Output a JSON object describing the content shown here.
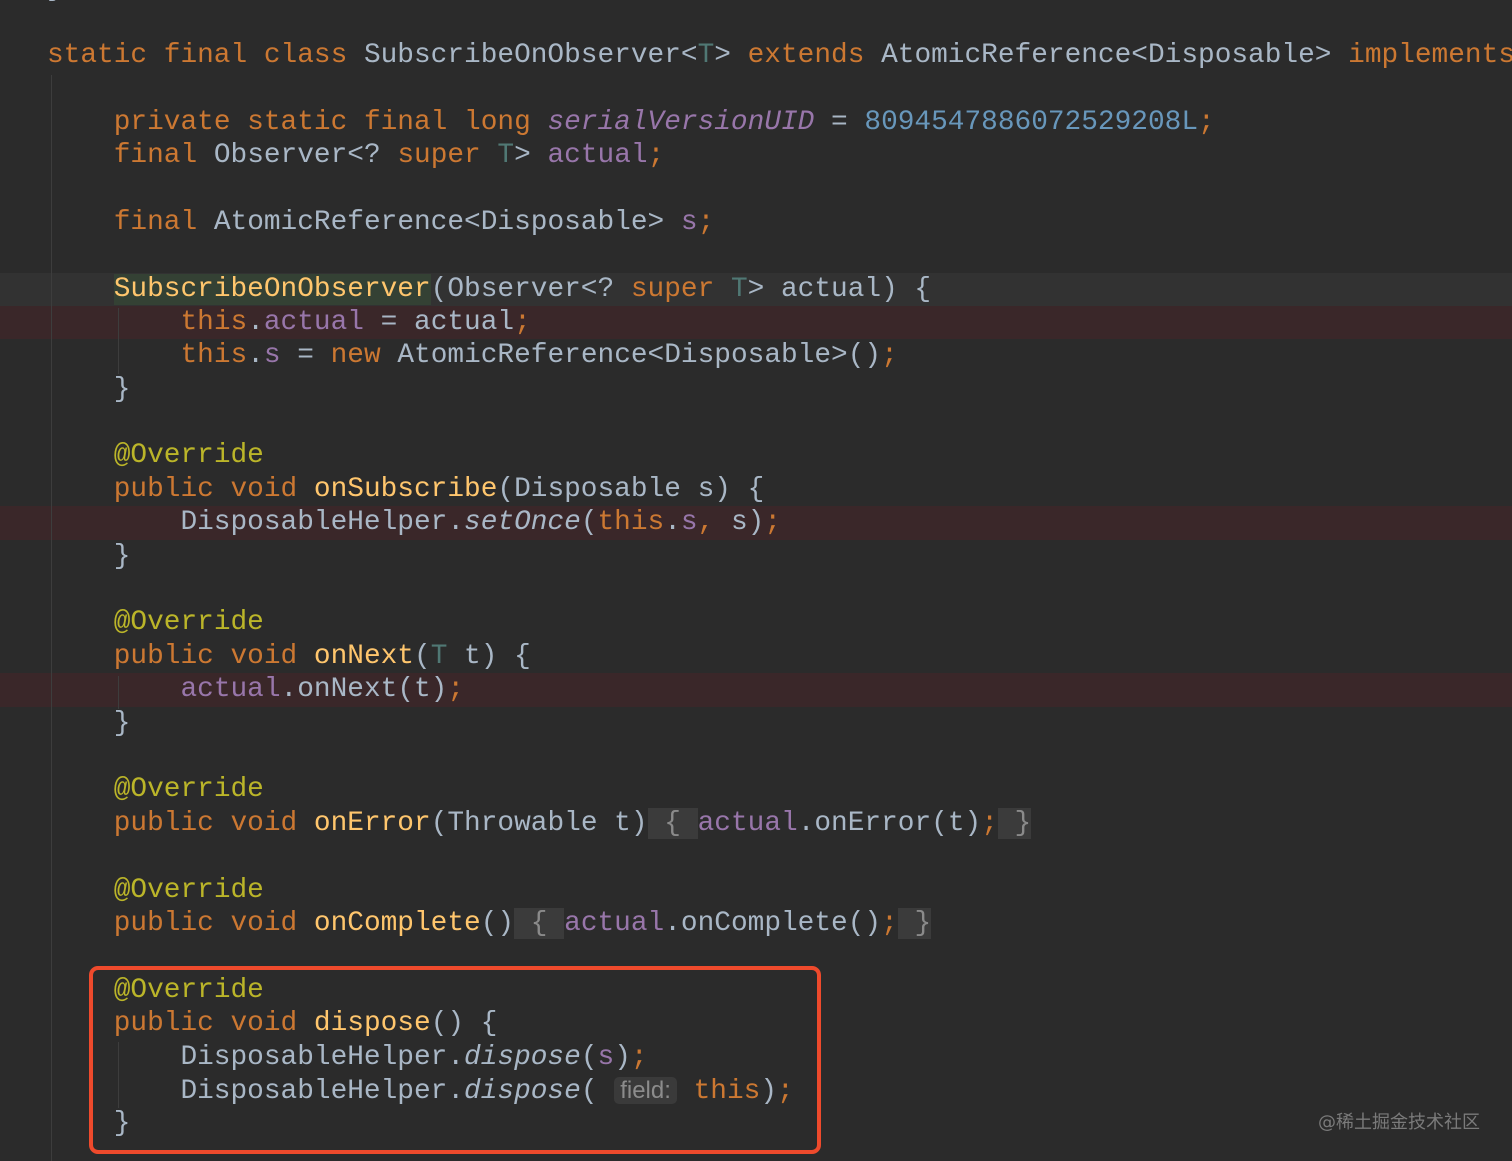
{
  "colors": {
    "background": "#2b2b2b",
    "keyword": "#cc7832",
    "text": "#a9b7c6",
    "field": "#9876aa",
    "number": "#6897bb",
    "annotation": "#bbb529",
    "method_declaration": "#ffc66d",
    "type_parameter": "#507874",
    "error_line": "#3a2729",
    "highlight_box": "#ee4a2c"
  },
  "code": {
    "lines": [
      {
        "tokens": [
          [
            "p",
            "}"
          ]
        ]
      },
      {
        "tokens": []
      },
      {
        "tokens": [
          [
            "k",
            "static final class "
          ],
          [
            "p",
            "SubscribeOnObserver<"
          ],
          [
            "t",
            "T"
          ],
          [
            "p",
            "> "
          ],
          [
            "k",
            "extends "
          ],
          [
            "p",
            "AtomicReference<Disposable> "
          ],
          [
            "k",
            "implements"
          ]
        ]
      },
      {
        "tokens": []
      },
      {
        "tokens": [
          [
            "p",
            "    "
          ],
          [
            "k",
            "private static final long "
          ],
          [
            "fi",
            "serialVersionUID"
          ],
          [
            "p",
            " = "
          ],
          [
            "n",
            "8094547886072529208L"
          ],
          [
            "k",
            ";"
          ]
        ]
      },
      {
        "tokens": [
          [
            "p",
            "    "
          ],
          [
            "k",
            "final "
          ],
          [
            "p",
            "Observer<? "
          ],
          [
            "k",
            "super "
          ],
          [
            "t",
            "T"
          ],
          [
            "p",
            "> "
          ],
          [
            "f",
            "actual"
          ],
          [
            "k",
            ";"
          ]
        ]
      },
      {
        "tokens": []
      },
      {
        "tokens": [
          [
            "p",
            "    "
          ],
          [
            "k",
            "final "
          ],
          [
            "p",
            "AtomicReference<Disposable> "
          ],
          [
            "f",
            "s"
          ],
          [
            "k",
            ";"
          ]
        ]
      },
      {
        "tokens": []
      },
      {
        "bg": "current",
        "tokens": [
          [
            "p",
            "    "
          ],
          [
            "mh",
            "SubscribeOnObserver"
          ],
          [
            "p",
            "(Observer<? "
          ],
          [
            "k",
            "super "
          ],
          [
            "t",
            "T"
          ],
          [
            "p",
            "> actual) {"
          ]
        ]
      },
      {
        "bg": "error",
        "tokens": [
          [
            "p",
            "        "
          ],
          [
            "k",
            "this"
          ],
          [
            "p",
            "."
          ],
          [
            "f",
            "actual"
          ],
          [
            "p",
            " = actual"
          ],
          [
            "k",
            ";"
          ]
        ]
      },
      {
        "tokens": [
          [
            "p",
            "        "
          ],
          [
            "k",
            "this"
          ],
          [
            "p",
            "."
          ],
          [
            "f",
            "s"
          ],
          [
            "p",
            " = "
          ],
          [
            "k",
            "new "
          ],
          [
            "p",
            "AtomicReference<Disposable>()"
          ],
          [
            "k",
            ";"
          ]
        ]
      },
      {
        "tokens": [
          [
            "p",
            "    }"
          ]
        ]
      },
      {
        "tokens": []
      },
      {
        "tokens": [
          [
            "p",
            "    "
          ],
          [
            "a",
            "@Override"
          ]
        ]
      },
      {
        "tokens": [
          [
            "p",
            "    "
          ],
          [
            "k",
            "public void "
          ],
          [
            "m",
            "onSubscribe"
          ],
          [
            "p",
            "(Disposable s) {"
          ]
        ]
      },
      {
        "bg": "error",
        "tokens": [
          [
            "p",
            "        DisposableHelper."
          ],
          [
            "i",
            "setOnce"
          ],
          [
            "p",
            "("
          ],
          [
            "k",
            "this"
          ],
          [
            "p",
            "."
          ],
          [
            "f",
            "s"
          ],
          [
            "k",
            ", "
          ],
          [
            "p",
            "s)"
          ],
          [
            "k",
            ";"
          ]
        ]
      },
      {
        "tokens": [
          [
            "p",
            "    }"
          ]
        ]
      },
      {
        "tokens": []
      },
      {
        "tokens": [
          [
            "p",
            "    "
          ],
          [
            "a",
            "@Override"
          ]
        ]
      },
      {
        "tokens": [
          [
            "p",
            "    "
          ],
          [
            "k",
            "public void "
          ],
          [
            "m",
            "onNext"
          ],
          [
            "p",
            "("
          ],
          [
            "t",
            "T"
          ],
          [
            "p",
            " t) {"
          ]
        ]
      },
      {
        "bg": "error",
        "tokens": [
          [
            "p",
            "        "
          ],
          [
            "f",
            "actual"
          ],
          [
            "p",
            ".onNext(t)"
          ],
          [
            "k",
            ";"
          ]
        ]
      },
      {
        "tokens": [
          [
            "p",
            "    }"
          ]
        ]
      },
      {
        "tokens": []
      },
      {
        "tokens": [
          [
            "p",
            "    "
          ],
          [
            "a",
            "@Override"
          ]
        ]
      },
      {
        "tokens": [
          [
            "p",
            "    "
          ],
          [
            "k",
            "public void "
          ],
          [
            "m",
            "onError"
          ],
          [
            "p",
            "(Throwable t)"
          ],
          [
            "fold",
            " { "
          ],
          [
            "f",
            "actual"
          ],
          [
            "p",
            ".onError(t)"
          ],
          [
            "k",
            ";"
          ],
          [
            "fold",
            " }"
          ]
        ]
      },
      {
        "tokens": []
      },
      {
        "tokens": [
          [
            "p",
            "    "
          ],
          [
            "a",
            "@Override"
          ]
        ]
      },
      {
        "tokens": [
          [
            "p",
            "    "
          ],
          [
            "k",
            "public void "
          ],
          [
            "m",
            "onComplete"
          ],
          [
            "p",
            "()"
          ],
          [
            "fold",
            " { "
          ],
          [
            "f",
            "actual"
          ],
          [
            "p",
            ".onComplete()"
          ],
          [
            "k",
            ";"
          ],
          [
            "fold",
            " }"
          ]
        ]
      },
      {
        "tokens": []
      },
      {
        "tokens": [
          [
            "p",
            "    "
          ],
          [
            "a",
            "@Override"
          ]
        ]
      },
      {
        "tokens": [
          [
            "p",
            "    "
          ],
          [
            "k",
            "public void "
          ],
          [
            "m",
            "dispose"
          ],
          [
            "p",
            "() {"
          ]
        ]
      },
      {
        "tokens": [
          [
            "p",
            "        DisposableHelper."
          ],
          [
            "i",
            "dispose"
          ],
          [
            "p",
            "("
          ],
          [
            "f",
            "s"
          ],
          [
            "p",
            ")"
          ],
          [
            "k",
            ";"
          ]
        ]
      },
      {
        "tokens": [
          [
            "p",
            "        DisposableHelper."
          ],
          [
            "i",
            "dispose"
          ],
          [
            "p",
            "( "
          ],
          [
            "hint",
            "field:"
          ],
          [
            "p",
            " "
          ],
          [
            "k",
            "this"
          ],
          [
            "p",
            ")"
          ],
          [
            "k",
            ";"
          ]
        ]
      },
      {
        "tokens": [
          [
            "p",
            "    }"
          ]
        ]
      }
    ]
  },
  "watermark": "@稀土掘金技术社区"
}
